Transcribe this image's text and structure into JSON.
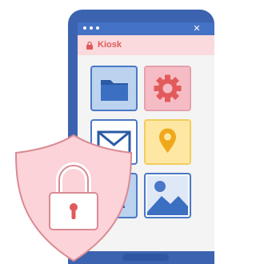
{
  "window": {
    "close_symbol": "✕"
  },
  "app": {
    "title": "Kiosk"
  },
  "tiles": [
    {
      "icon": "folder-icon"
    },
    {
      "icon": "gear-icon"
    },
    {
      "icon": "mail-icon"
    },
    {
      "icon": "location-pin-icon"
    },
    {
      "icon": "people-icon"
    },
    {
      "icon": "image-icon"
    }
  ],
  "overlay": {
    "icon": "security-shield-lock-icon"
  },
  "colors": {
    "frame": "#3c63b0",
    "titlebar": "#4472c4",
    "appbar": "#fadadd",
    "accent_red": "#e05a5a",
    "shield_fill": "#fbd3d8",
    "shield_stroke": "#d98a93"
  }
}
